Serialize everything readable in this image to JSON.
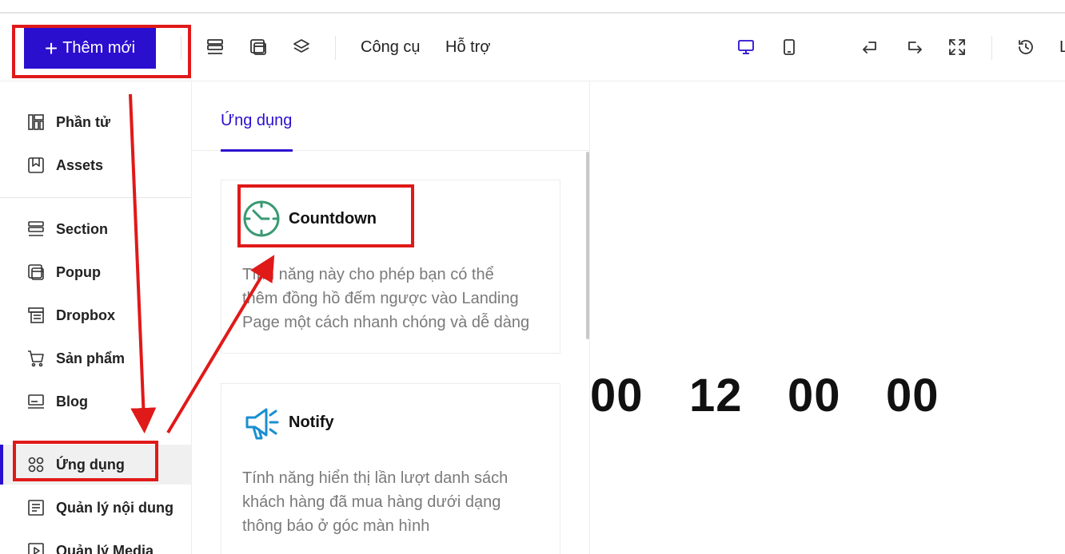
{
  "toolbar": {
    "add_button_label": "Thêm mới",
    "menu_tools": "Công cụ",
    "menu_support": "Hỗ trợ",
    "partial_text": "L"
  },
  "sidebar": {
    "items": [
      {
        "label": "Phần tử"
      },
      {
        "label": "Assets"
      },
      {
        "label": "Section"
      },
      {
        "label": "Popup"
      },
      {
        "label": "Dropbox"
      },
      {
        "label": "Sản phẩm"
      },
      {
        "label": "Blog"
      },
      {
        "label": "Ứng dụng"
      },
      {
        "label": "Quản lý nội dung"
      },
      {
        "label": "Quản lý Media"
      }
    ],
    "active_item": "Ứng dụng"
  },
  "panel": {
    "tab_label": "Ứng dụng",
    "cards": [
      {
        "title": "Countdown",
        "desc_lines": [
          "Tính năng này cho phép bạn có thể",
          "thêm đồng hồ đếm ngược vào Landing",
          "Page một cách nhanh chóng và dễ dàng"
        ]
      },
      {
        "title": "Notify",
        "desc_lines": [
          "Tính năng hiển thị lần lượt danh sách",
          "khách hàng đã mua hàng dưới dạng",
          "thông báo ở góc màn hình"
        ]
      }
    ]
  },
  "canvas": {
    "countdown_values": [
      "00",
      "12",
      "00",
      "00"
    ]
  },
  "colors": {
    "primary": "#2a0fcf",
    "annotation_red": "#e01919",
    "countdown_icon": "#3a9a72",
    "notify_icon": "#1a8fd0"
  }
}
